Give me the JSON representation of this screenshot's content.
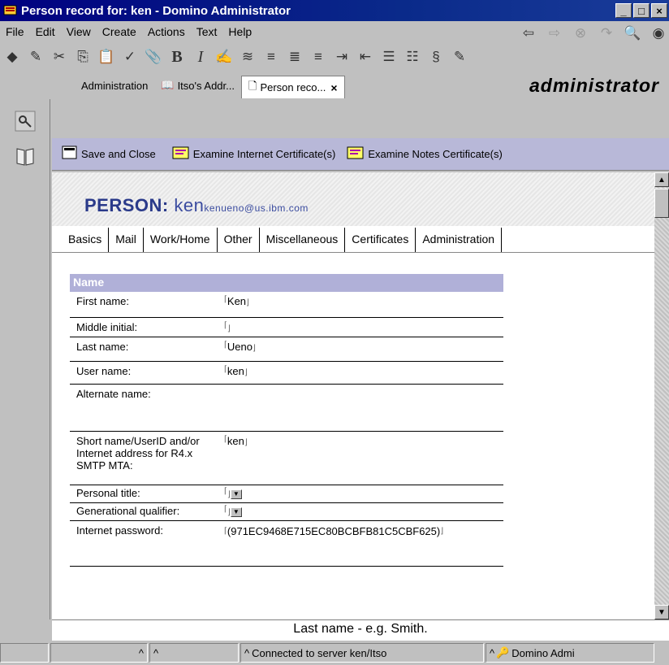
{
  "window": {
    "title": "Person record for: ken - Domino Administrator",
    "controls": [
      "_",
      "□",
      "×"
    ]
  },
  "menu": [
    "File",
    "Edit",
    "View",
    "Create",
    "Actions",
    "Text",
    "Help"
  ],
  "toolbar": {
    "bold": "B",
    "italic": "I"
  },
  "tabs": [
    {
      "label": "Administration"
    },
    {
      "label": "Itso's Addr..."
    },
    {
      "label": "Person reco...",
      "close": "×"
    }
  ],
  "brand": "administrator",
  "actions": [
    {
      "label": "Save and Close"
    },
    {
      "label": "Examine Internet Certificate(s)"
    },
    {
      "label": "Examine Notes Certificate(s)"
    }
  ],
  "person": {
    "label": "PERSON:",
    "name": "ken",
    "email": "kenueno@us.ibm.com"
  },
  "doc_tabs": [
    "Basics",
    "Mail",
    "Work/Home",
    "Other",
    "Miscellaneous",
    "Certificates",
    "Administration"
  ],
  "section": "Name",
  "fields": [
    {
      "label": "First name:",
      "value": "Ken"
    },
    {
      "label": "Middle initial:",
      "value": ""
    },
    {
      "label": "Last name:",
      "value": "Ueno"
    },
    {
      "label": "User name:",
      "value": "ken"
    },
    {
      "label": "Alternate name:",
      "value": ""
    },
    {
      "label": "Short name/UserID and/or Internet address for R4.x SMTP MTA:",
      "value": "ken"
    },
    {
      "label": "Personal title:",
      "value": ""
    },
    {
      "label": "Generational qualifier:",
      "value": ""
    },
    {
      "label": "Internet password:",
      "value": "(971EC9468E715EC80BCBFB81C5CBF625)"
    }
  ],
  "hint": "Last name - e.g. Smith.",
  "status": {
    "server": "Connected to server ken/Itso",
    "app": "Domino Admi"
  },
  "colors": {
    "titlebar": "#000080",
    "actionbar": "#b8b8d8",
    "section": "#b0b0d8",
    "person_text": "#2a3a8a"
  }
}
